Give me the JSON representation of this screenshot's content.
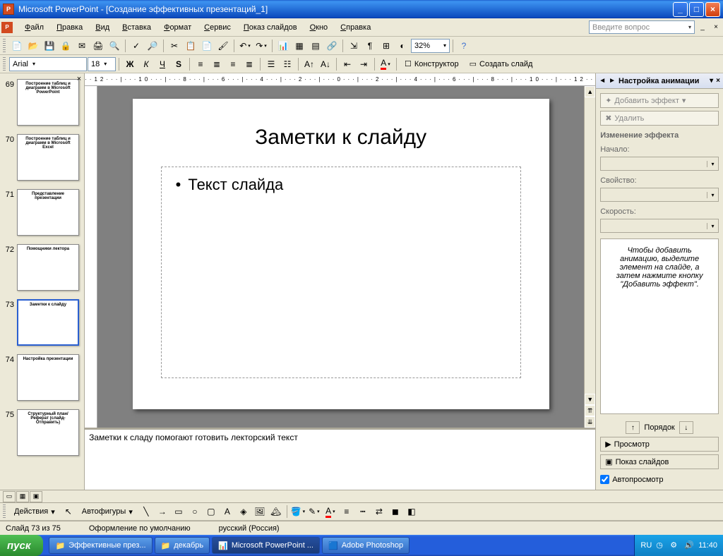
{
  "titlebar": {
    "app": "Microsoft PowerPoint",
    "doc": "[Создание эффективных презентаций_1]"
  },
  "menubar": {
    "items": [
      "Файл",
      "Правка",
      "Вид",
      "Вставка",
      "Формат",
      "Сервис",
      "Показ слайдов",
      "Окно",
      "Справка"
    ],
    "ask_placeholder": "Введите вопрос"
  },
  "toolbar_std": {
    "zoom": "32%"
  },
  "toolbar_fmt": {
    "font": "Arial",
    "size": "18",
    "designer": "Конструктор",
    "new_slide": "Создать слайд"
  },
  "ruler_h": "··12···|···10···|···8···|···6···|···4···|···2···|···0···|···2···|···4···|···6···|···8···|···10···|···12··",
  "thumbs": [
    {
      "num": "69",
      "title": "Построение таблиц и диаграмм в Microsoft PowerPoint",
      "sel": false
    },
    {
      "num": "70",
      "title": "Построение таблиц и диаграмм в Microsoft Excel",
      "sel": false
    },
    {
      "num": "71",
      "title": "Представление презентации",
      "sel": false
    },
    {
      "num": "72",
      "title": "Помощники лектора",
      "sel": false
    },
    {
      "num": "73",
      "title": "Заметки к слайду",
      "sel": true
    },
    {
      "num": "74",
      "title": "Настройка презентации",
      "sel": false
    },
    {
      "num": "75",
      "title": "Структурный план/Реферат (слайд-Отправить)",
      "sel": false
    }
  ],
  "slide": {
    "title": "Заметки к слайду",
    "bullet": "Текст слайда"
  },
  "notes": "Заметки к сладу помогают готовить лекторский текст",
  "taskpane": {
    "title": "Настройка анимации",
    "add_effect": "Добавить эффект",
    "delete": "Удалить",
    "section": "Изменение эффекта",
    "start_label": "Начало:",
    "prop_label": "Свойство:",
    "speed_label": "Скорость:",
    "hint": "Чтобы добавить анимацию, выделите элемент на слайде, а затем нажмите кнопку \"Добавить эффект\".",
    "order": "Порядок",
    "preview": "Просмотр",
    "slideshow": "Показ слайдов",
    "autopreview": "Автопросмотр"
  },
  "drawbar": {
    "actions": "Действия",
    "autoshapes": "Автофигуры"
  },
  "statusbar": {
    "slide": "Слайд 73 из 75",
    "design": "Оформление по умолчанию",
    "lang": "русский (Россия)"
  },
  "taskbar": {
    "start": "пуск",
    "buttons": [
      {
        "label": "Эффективные през...",
        "icon": "folder"
      },
      {
        "label": "декабрь",
        "icon": "folder"
      },
      {
        "label": "Microsoft PowerPoint ...",
        "icon": "ppt",
        "active": true
      },
      {
        "label": "Adobe Photoshop",
        "icon": "ps"
      }
    ],
    "lang": "RU",
    "clock": "11:40"
  }
}
